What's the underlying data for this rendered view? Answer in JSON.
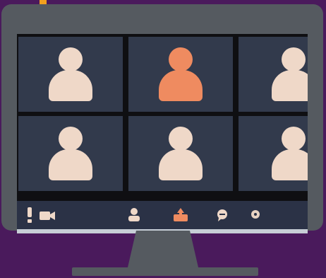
{
  "colors": {
    "background": "#4a1a5c",
    "accent": "#f2a01e",
    "monitor": "#555a60",
    "tile": "#323a4c",
    "avatar_default": "#efd8c8",
    "avatar_active": "#ef8b60",
    "toolbar": "#2b3246",
    "toolbar_icon_light": "#efd8c8",
    "toolbar_icon_orange": "#ef8b60",
    "toolbar_icon_pale": "#e8d2c2"
  },
  "participants": [
    {
      "state": "idle"
    },
    {
      "state": "speaking"
    },
    {
      "state": "idle"
    },
    {
      "state": "idle"
    },
    {
      "state": "idle"
    },
    {
      "state": "idle"
    }
  ],
  "toolbar": {
    "icons": [
      "alert-icon",
      "video-camera-icon",
      "participants-icon",
      "share-screen-icon",
      "chat-icon",
      "settings-icon"
    ]
  }
}
